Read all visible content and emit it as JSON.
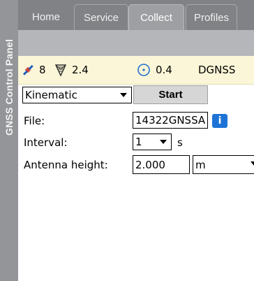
{
  "side_panel": {
    "title": "GNSS Control Panel"
  },
  "tabs": [
    {
      "label": "Home",
      "active": false
    },
    {
      "label": "Service",
      "active": false
    },
    {
      "label": "Collect",
      "active": true
    },
    {
      "label": "Profiles",
      "active": false
    }
  ],
  "status": {
    "satellites": "8",
    "pdop": "2.4",
    "accuracy": "0.4",
    "solution": "DGNSS"
  },
  "collect": {
    "mode": {
      "value": "Kinematic"
    },
    "start_label": "Start",
    "file": {
      "label": "File:",
      "value": "14322GNSSA"
    },
    "interval": {
      "label": "Interval:",
      "value": "1",
      "unit": "s"
    },
    "antenna": {
      "label": "Antenna height:",
      "value": "2.000",
      "unit": "m"
    }
  },
  "colors": {
    "tabbar": "#808285",
    "side_panel": "#939598",
    "status_bg": "#fbf6d7",
    "info_icon": "#1e74d6"
  }
}
